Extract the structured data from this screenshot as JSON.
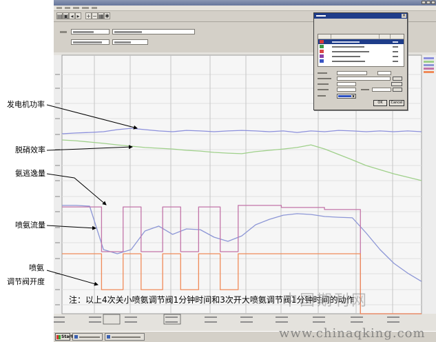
{
  "window": {
    "toolbar_icons": [
      "open-icon",
      "save-icon",
      "back-icon",
      "forward-icon",
      "zoom-in-icon",
      "zoom-out-icon",
      "print-icon",
      "settings-icon"
    ],
    "taskbar": {
      "start_label": "Start"
    }
  },
  "dialog": {
    "row_colors": [
      "#d83a3a",
      "#3c9c46",
      "#d84848",
      "#8a42a8",
      "#3a56c4"
    ],
    "color_swatch": "#2a4fc0",
    "ok_label": "OK",
    "cancel_label": "Cancel"
  },
  "watermark": {
    "site": "中国期刊网",
    "url": "www.chinaqking.com"
  },
  "colors": {
    "title_bar": "#66759a",
    "dialog_title": "#1f3d8a",
    "window_face": "#d4d0c8",
    "plot_background": "#f6f6f6"
  },
  "chart_data": {
    "type": "line",
    "ylim": [
      0,
      100
    ],
    "grid": true,
    "note": "注：以上4次关小喷氨调节阀1分钟时间和3次开大喷氨调节阀1分钟时间的动作",
    "series": [
      {
        "name": "发电机功率",
        "color": "#8b8fdc",
        "values": [
          69.6,
          69.9,
          70.1,
          70.4,
          71.2,
          71.7,
          71.2,
          70.7,
          70.4,
          70.9,
          70.7,
          70.4,
          70.7,
          70.9,
          70.7,
          70.4,
          70.7,
          70.1,
          70.7,
          70.4,
          70.9,
          70.7,
          70.4,
          70.7,
          70.4,
          70.7,
          70.4
        ]
      },
      {
        "name": "脱硝效率",
        "color": "#9fd08a",
        "values": [
          67.2,
          66.9,
          66.4,
          65.9,
          65.3,
          64.8,
          64.3,
          64.0,
          63.7,
          63.2,
          62.9,
          62.4,
          62.1,
          61.9,
          62.7,
          63.2,
          63.7,
          64.3,
          65.3,
          63.7,
          61.6,
          59.5,
          57.3,
          55.7,
          54.1,
          52.8,
          51.5
        ]
      },
      {
        "name": "氨逃逸量",
        "color": "#8c96d6",
        "values": [
          41.9,
          41.9,
          41.6,
          24.8,
          23.2,
          24.8,
          32.0,
          33.9,
          30.7,
          32.8,
          32.5,
          29.6,
          28.0,
          30.1,
          34.4,
          36.5,
          38.1,
          38.7,
          38.4,
          37.6,
          37.3,
          37.1,
          31.2,
          24.8,
          19.5,
          15.7,
          12.5
        ]
      },
      {
        "name": "喷氨流量",
        "color": "#c274a8",
        "step": true,
        "values": [
          41.3,
          41.3,
          41.3,
          41.3,
          41.3,
          41.3,
          41.3,
          41.3,
          41.3,
          41.3,
          41.3,
          24.0,
          24.0,
          24.0,
          24.0,
          24.0,
          24.0,
          41.3,
          41.3,
          41.3,
          41.3,
          41.3,
          24.0,
          24.0,
          24.0,
          24.0,
          24.0,
          24.0,
          41.3,
          41.3,
          41.3,
          41.3,
          41.3,
          24.0,
          24.0,
          24.0,
          24.0,
          24.0,
          41.3,
          41.3,
          41.3,
          41.3,
          41.3,
          41.3,
          24.0,
          24.0,
          24.0,
          24.0,
          24.0,
          41.9,
          41.9,
          41.9,
          41.9,
          41.9,
          41.9,
          41.9,
          41.9,
          41.9,
          41.9,
          41.9,
          41.9,
          41.1,
          41.1,
          41.1,
          41.1,
          41.1,
          41.1,
          41.1,
          41.1,
          41.1,
          41.1,
          41.1,
          41.1,
          40.3,
          40.3,
          40.3,
          40.3,
          40.3,
          40.3,
          40.3,
          40.3,
          40.3,
          40.3,
          0,
          0,
          0,
          0,
          0,
          0,
          0,
          0,
          0,
          0,
          0,
          0,
          0,
          0,
          0,
          0,
          0,
          0
        ]
      },
      {
        "name_lines": [
          "喷氨",
          "调节阀开度"
        ],
        "color": "#f08a58",
        "step": true,
        "values": [
          23.2,
          23.2,
          23.2,
          23.2,
          23.2,
          23.2,
          23.2,
          23.2,
          23.2,
          23.2,
          23.2,
          9.3,
          9.3,
          9.3,
          9.3,
          9.3,
          9.3,
          23.2,
          23.2,
          23.2,
          23.2,
          23.2,
          9.3,
          9.3,
          9.3,
          9.3,
          9.3,
          9.3,
          23.2,
          23.2,
          23.2,
          23.2,
          23.2,
          9.3,
          9.3,
          9.3,
          9.3,
          9.3,
          23.2,
          23.2,
          23.2,
          23.2,
          23.2,
          23.2,
          9.3,
          9.3,
          9.3,
          9.3,
          9.3,
          23.2,
          23.2,
          23.2,
          23.2,
          23.2,
          23.2,
          23.2,
          23.2,
          23.2,
          23.2,
          23.2,
          23.2,
          23.2,
          23.2,
          23.2,
          23.2,
          23.2,
          23.2,
          23.2,
          23.2,
          23.2,
          23.2,
          23.2,
          23.2,
          23.2,
          23.2,
          23.2,
          23.2,
          23.2,
          23.2,
          23.2,
          23.2,
          23.2,
          23.2,
          0,
          0,
          0,
          0,
          0,
          0,
          0,
          0,
          0,
          0,
          0,
          0,
          0,
          0,
          0,
          0,
          0,
          0
        ]
      }
    ]
  }
}
